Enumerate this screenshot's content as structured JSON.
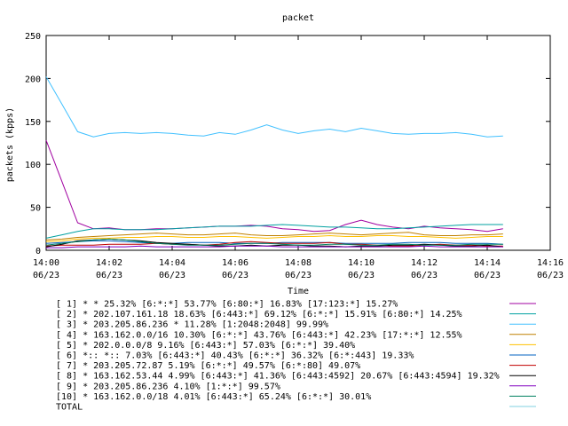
{
  "chart_data": {
    "type": "line",
    "title": "packet",
    "xlabel": "Time",
    "ylabel": "packets (kpps)",
    "ylim": [
      0,
      250
    ],
    "yticks": [
      0,
      50,
      100,
      150,
      200,
      250
    ],
    "xlim": [
      0,
      16
    ],
    "xticks": [
      {
        "value": 0,
        "time": "14:00",
        "date": "06/23"
      },
      {
        "value": 2,
        "time": "14:02",
        "date": "06/23"
      },
      {
        "value": 4,
        "time": "14:04",
        "date": "06/23"
      },
      {
        "value": 6,
        "time": "14:06",
        "date": "06/23"
      },
      {
        "value": 8,
        "time": "14:08",
        "date": "06/23"
      },
      {
        "value": 10,
        "time": "14:10",
        "date": "06/23"
      },
      {
        "value": 12,
        "time": "14:12",
        "date": "06/23"
      },
      {
        "value": 14,
        "time": "14:14",
        "date": "06/23"
      },
      {
        "value": 16,
        "time": "14:16",
        "date": "06/23"
      }
    ],
    "x": [
      0,
      0.5,
      1,
      1.5,
      2,
      2.5,
      3,
      3.5,
      4,
      4.5,
      5,
      5.5,
      6,
      6.5,
      7,
      7.5,
      8,
      8.5,
      9,
      9.5,
      10,
      10.5,
      11,
      11.5,
      12,
      12.5,
      13,
      13.5,
      14,
      14.5
    ],
    "grid": false,
    "legend_position": "bottom",
    "series": [
      {
        "name": "[ 1] * * 25.32%  [6:*:*] 53.77% [6:80:*] 16.83% [17:123:*] 15.27%",
        "color": "#a000a0",
        "values": [
          128,
          80,
          32,
          25,
          26,
          24,
          24,
          25,
          25,
          26,
          27,
          28,
          28,
          29,
          28,
          25,
          24,
          22,
          23,
          30,
          35,
          30,
          27,
          25,
          28,
          26,
          25,
          24,
          22,
          25
        ]
      },
      {
        "name": "[ 2] * 202.107.161.18 18.63%  [6:443:*] 69.12% [6:*:*] 15.91% [6:80:*] 14.25%",
        "color": "#00a0a0",
        "values": [
          14,
          18,
          22,
          25,
          25,
          24,
          24,
          24,
          25,
          26,
          27,
          28,
          28,
          28,
          29,
          30,
          29,
          28,
          27,
          27,
          26,
          25,
          25,
          26,
          27,
          28,
          29,
          30,
          30,
          30
        ]
      },
      {
        "name": "[ 3] * 203.205.86.236 * 11.28%  [1:2048:2048] 99.99%",
        "color": "#40c0ff",
        "values": [
          202,
          170,
          138,
          132,
          136,
          137,
          136,
          137,
          136,
          134,
          133,
          137,
          135,
          140,
          146,
          140,
          136,
          139,
          141,
          138,
          142,
          139,
          136,
          135,
          136,
          136,
          137,
          135,
          132,
          133
        ]
      },
      {
        "name": "[ 4] * 163.162.0.0/16 10.30%  [6:*:*] 43.76% [6:443:*] 42.23% [17:*:*] 12.55%",
        "color": "#c08000",
        "values": [
          12,
          13,
          15,
          16,
          17,
          18,
          19,
          20,
          19,
          18,
          18,
          19,
          20,
          18,
          17,
          17,
          18,
          19,
          20,
          19,
          18,
          19,
          20,
          21,
          18,
          17,
          17,
          18,
          18,
          19
        ]
      },
      {
        "name": "[ 5] * 202.0.0.0/8 9.16%  [6:443:*] 57.03% [6:*:*] 39.40%",
        "color": "#ffc000",
        "values": [
          10,
          11,
          13,
          14,
          14,
          15,
          15,
          16,
          16,
          15,
          15,
          16,
          16,
          15,
          14,
          15,
          16,
          16,
          17,
          16,
          16,
          17,
          17,
          16,
          16,
          15,
          14,
          15,
          16,
          16
        ]
      },
      {
        "name": "[ 6] *:: *:: 7.03%  [6:443:*] 40.43% [6:*:*] 36.32% [6:*:443] 19.33%",
        "color": "#0060c0",
        "values": [
          8,
          9,
          10,
          11,
          11,
          10,
          9,
          8,
          8,
          9,
          9,
          9,
          8,
          8,
          8,
          9,
          9,
          9,
          9,
          8,
          8,
          8,
          8,
          9,
          9,
          9,
          8,
          8,
          8,
          7
        ]
      },
      {
        "name": "[ 7] * 203.205.72.87 5.19%  [6:*:*] 49.57% [6:*:80] 49.07%",
        "color": "#c00000",
        "values": [
          5,
          6,
          6,
          6,
          7,
          7,
          7,
          8,
          7,
          7,
          6,
          7,
          9,
          10,
          9,
          8,
          8,
          8,
          9,
          7,
          7,
          6,
          5,
          5,
          6,
          7,
          6,
          6,
          5,
          5
        ]
      },
      {
        "name": "[ 8] * 163.162.53.44 4.99%  [6:443:*] 41.36% [6:443:4592] 20.67% [6:443:4594] 19.32%",
        "color": "#000000",
        "values": [
          4,
          7,
          11,
          12,
          13,
          12,
          11,
          9,
          8,
          7,
          6,
          5,
          5,
          6,
          5,
          6,
          6,
          5,
          5,
          4,
          5,
          5,
          6,
          6,
          7,
          6,
          5,
          5,
          6,
          4
        ]
      },
      {
        "name": "[ 9] * 203.205.86.236 4.10%  [1:*:*] 99.57%",
        "color": "#8000c0",
        "values": [
          3,
          3,
          4,
          4,
          4,
          4,
          5,
          4,
          4,
          4,
          4,
          4,
          5,
          5,
          5,
          4,
          4,
          4,
          4,
          4,
          4,
          4,
          4,
          4,
          5,
          4,
          4,
          4,
          4,
          4
        ]
      },
      {
        "name": "[10] * 163.162.0.0/18 4.01%  [6:443:*] 65.24% [6:*:*] 30.01%",
        "color": "#008060",
        "values": [
          6,
          8,
          10,
          12,
          13,
          12,
          10,
          8,
          7,
          6,
          6,
          6,
          7,
          8,
          8,
          7,
          6,
          6,
          7,
          7,
          6,
          6,
          7,
          7,
          6,
          6,
          6,
          7,
          7,
          7
        ]
      },
      {
        "name": "TOTAL",
        "color": "#80d0e0",
        "values": null
      }
    ]
  }
}
